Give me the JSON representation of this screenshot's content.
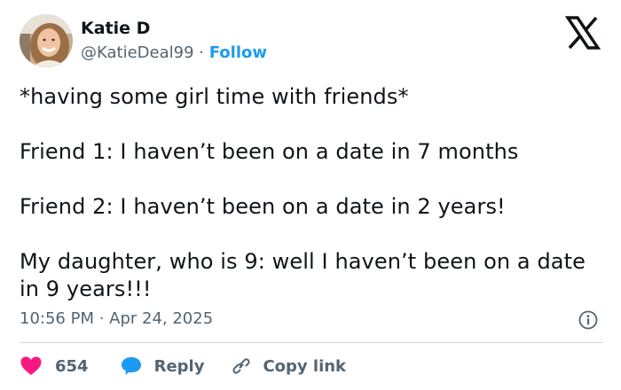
{
  "author": {
    "display_name": "Katie D",
    "handle": "@KatieDeal99",
    "separator": "·",
    "follow_label": "Follow"
  },
  "tweet": {
    "text": "*having some girl time with friends*\n\nFriend 1: I haven’t been on a date in 7 months\n\nFriend 2: I haven’t been on a date in 2 years!\n\nMy daughter, who is 9: well I haven’t been on a date in 9 years!!!",
    "timestamp": "10:56 PM · Apr 24, 2025"
  },
  "actions": {
    "like_count": "654",
    "reply_label": "Reply",
    "copy_link_label": "Copy link"
  },
  "icons": {
    "brand": "x-logo-icon",
    "info": "info-icon",
    "like": "heart-icon",
    "reply": "speech-bubble-icon",
    "copy": "link-icon"
  },
  "colors": {
    "text": "#0f1419",
    "muted": "#536471",
    "accent": "#1d9bf0",
    "like": "#f91880",
    "divider": "#cfd9de"
  }
}
